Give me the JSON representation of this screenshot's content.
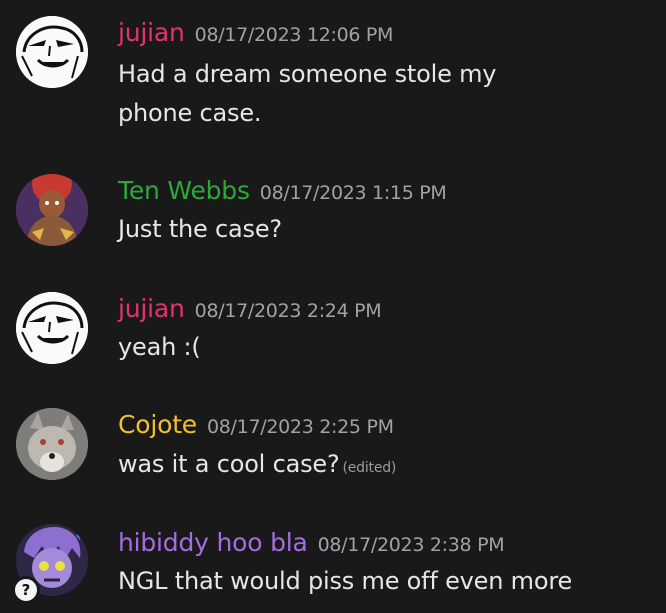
{
  "messages": [
    {
      "author": "jujian",
      "author_color": "#e4316f",
      "timestamp": "08/17/2023 12:06 PM",
      "lines": [
        "Had a dream someone stole my",
        "phone case."
      ],
      "avatar_icon": "meme-face-avatar"
    },
    {
      "author": "Ten Webbs",
      "author_color": "#2ea73a",
      "timestamp": "08/17/2023 1:15 PM",
      "lines": [
        "Just the case?"
      ],
      "avatar_icon": "character-art-avatar"
    },
    {
      "author": "jujian",
      "author_color": "#e4316f",
      "timestamp": "08/17/2023 2:24 PM",
      "lines": [
        "yeah :("
      ],
      "avatar_icon": "meme-face-avatar"
    },
    {
      "author": "Cojote",
      "author_color": "#f2c029",
      "timestamp": "08/17/2023 2:25 PM",
      "lines": [
        "was it a cool case?"
      ],
      "edited_label": "(edited)",
      "avatar_icon": "coyote-photo-avatar"
    },
    {
      "author": "hibiddy hoo bla",
      "author_color": "#a56ce0",
      "timestamp": "08/17/2023 2:38 PM",
      "lines": [
        "NGL that would piss me off even more"
      ],
      "avatar_icon": "purple-character-avatar",
      "badge_icon": "question-mark-icon"
    }
  ]
}
